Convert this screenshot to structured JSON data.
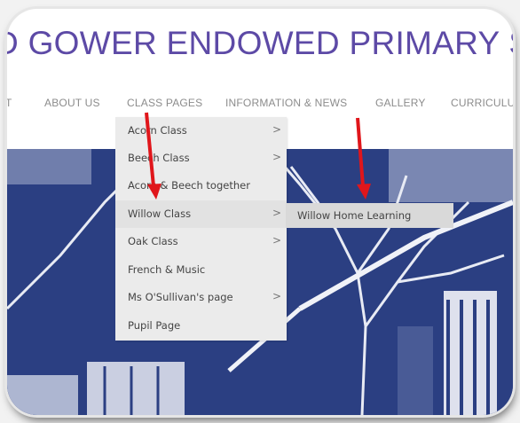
{
  "site": {
    "title": "D GOWER ENDOWED PRIMARY SC"
  },
  "nav": {
    "items": [
      {
        "label": "T"
      },
      {
        "label": "ABOUT US"
      },
      {
        "label": "CLASS PAGES"
      },
      {
        "label": "INFORMATION & NEWS"
      },
      {
        "label": "GALLERY"
      },
      {
        "label": "CURRICULUM"
      }
    ]
  },
  "dropdown": {
    "items": [
      {
        "label": "Acorn Class",
        "chevron": ">"
      },
      {
        "label": "Beech Class",
        "chevron": ">"
      },
      {
        "label": "Acorn & Beech together",
        "chevron": ""
      },
      {
        "label": "Willow Class",
        "chevron": ">"
      },
      {
        "label": "Oak Class",
        "chevron": ">"
      },
      {
        "label": "French & Music",
        "chevron": ""
      },
      {
        "label": "Ms O'Sullivan's page",
        "chevron": ">"
      },
      {
        "label": "Pupil Page",
        "chevron": ""
      }
    ]
  },
  "submenu": {
    "items": [
      {
        "label": "Willow Home Learning"
      }
    ]
  },
  "colors": {
    "title": "#5d4aa6",
    "nav_text": "#8c8c8c",
    "menu_bg": "#ebebeb",
    "submenu_bg": "#d9d9d9",
    "hero_blue": "#2b3f82",
    "annotation_arrow": "#e0161b"
  },
  "icons": {
    "chevron": "chevron-right-icon",
    "arrow": "red-annotation-arrow-icon"
  }
}
